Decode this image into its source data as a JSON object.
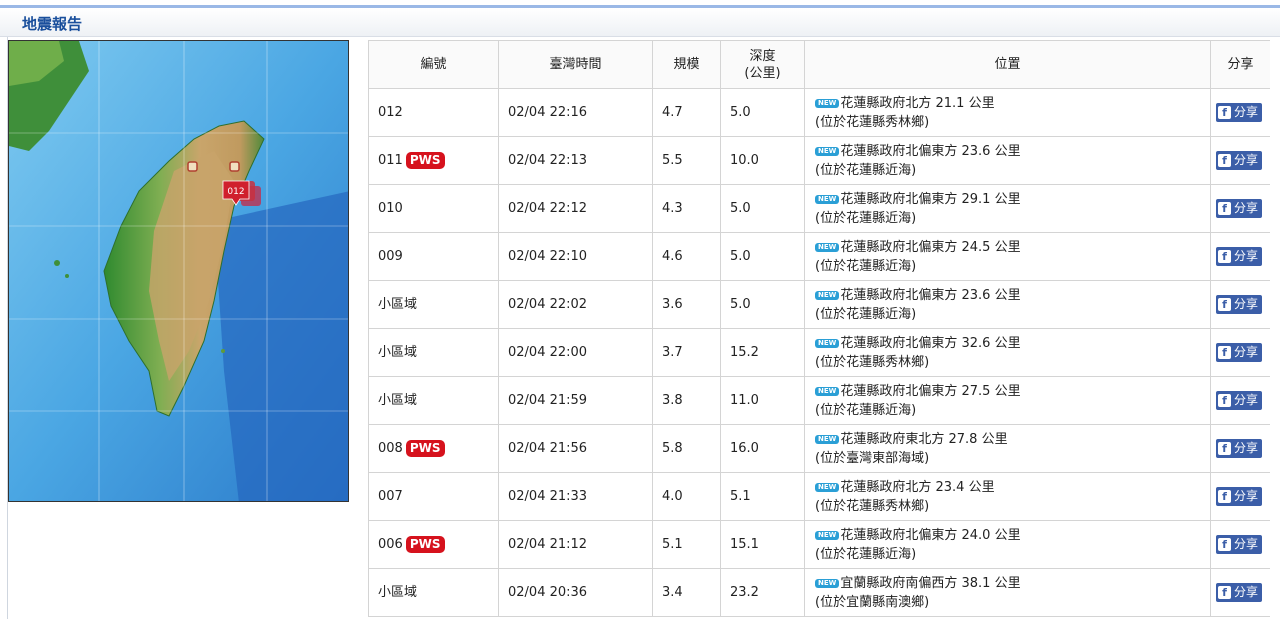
{
  "header": {
    "title": "地震報告"
  },
  "table": {
    "columns": [
      "編號",
      "臺灣時間",
      "規模",
      "深度",
      "(公里)",
      "位置",
      "分享"
    ],
    "new_badge": "NEW",
    "pws_label": "PWS",
    "share_label": "分享",
    "share_icon_glyph": "f",
    "rows": [
      {
        "id": "012",
        "pws": false,
        "time": "02/04 22:16",
        "mag": "4.7",
        "depth": "5.0",
        "loc1": "花蓮縣政府北方 21.1 公里",
        "loc2": "(位於花蓮縣秀林鄉)"
      },
      {
        "id": "011",
        "pws": true,
        "time": "02/04 22:13",
        "mag": "5.5",
        "depth": "10.0",
        "loc1": "花蓮縣政府北偏東方 23.6 公里",
        "loc2": "(位於花蓮縣近海)"
      },
      {
        "id": "010",
        "pws": false,
        "time": "02/04 22:12",
        "mag": "4.3",
        "depth": "5.0",
        "loc1": "花蓮縣政府北偏東方 29.1 公里",
        "loc2": "(位於花蓮縣近海)"
      },
      {
        "id": "009",
        "pws": false,
        "time": "02/04 22:10",
        "mag": "4.6",
        "depth": "5.0",
        "loc1": "花蓮縣政府北偏東方 24.5 公里",
        "loc2": "(位於花蓮縣近海)"
      },
      {
        "id": "小區域",
        "pws": false,
        "time": "02/04 22:02",
        "mag": "3.6",
        "depth": "5.0",
        "loc1": "花蓮縣政府北偏東方 23.6 公里",
        "loc2": "(位於花蓮縣近海)"
      },
      {
        "id": "小區域",
        "pws": false,
        "time": "02/04 22:00",
        "mag": "3.7",
        "depth": "15.2",
        "loc1": "花蓮縣政府北偏東方 32.6 公里",
        "loc2": "(位於花蓮縣秀林鄉)"
      },
      {
        "id": "小區域",
        "pws": false,
        "time": "02/04 21:59",
        "mag": "3.8",
        "depth": "11.0",
        "loc1": "花蓮縣政府北偏東方 27.5 公里",
        "loc2": "(位於花蓮縣近海)"
      },
      {
        "id": "008",
        "pws": true,
        "time": "02/04 21:56",
        "mag": "5.8",
        "depth": "16.0",
        "loc1": "花蓮縣政府東北方 27.8 公里",
        "loc2": "(位於臺灣東部海域)"
      },
      {
        "id": "007",
        "pws": false,
        "time": "02/04 21:33",
        "mag": "4.0",
        "depth": "5.1",
        "loc1": "花蓮縣政府北方 23.4 公里",
        "loc2": "(位於花蓮縣秀林鄉)"
      },
      {
        "id": "006",
        "pws": true,
        "time": "02/04 21:12",
        "mag": "5.1",
        "depth": "15.1",
        "loc1": "花蓮縣政府北偏東方 24.0 公里",
        "loc2": "(位於花蓮縣近海)"
      },
      {
        "id": "小區域",
        "pws": false,
        "time": "02/04 20:36",
        "mag": "3.4",
        "depth": "23.2",
        "loc1": "宜蘭縣政府南偏西方 38.1 公里",
        "loc2": "(位於宜蘭縣南澳鄉)"
      }
    ]
  },
  "map": {
    "marker_label": "012",
    "colors": {
      "sea": "#49a9e6",
      "deep_sea": "#1f6fc4",
      "lowland": "#2f8a2f",
      "highland": "#c9a56b",
      "marker": "#d0202d"
    }
  }
}
